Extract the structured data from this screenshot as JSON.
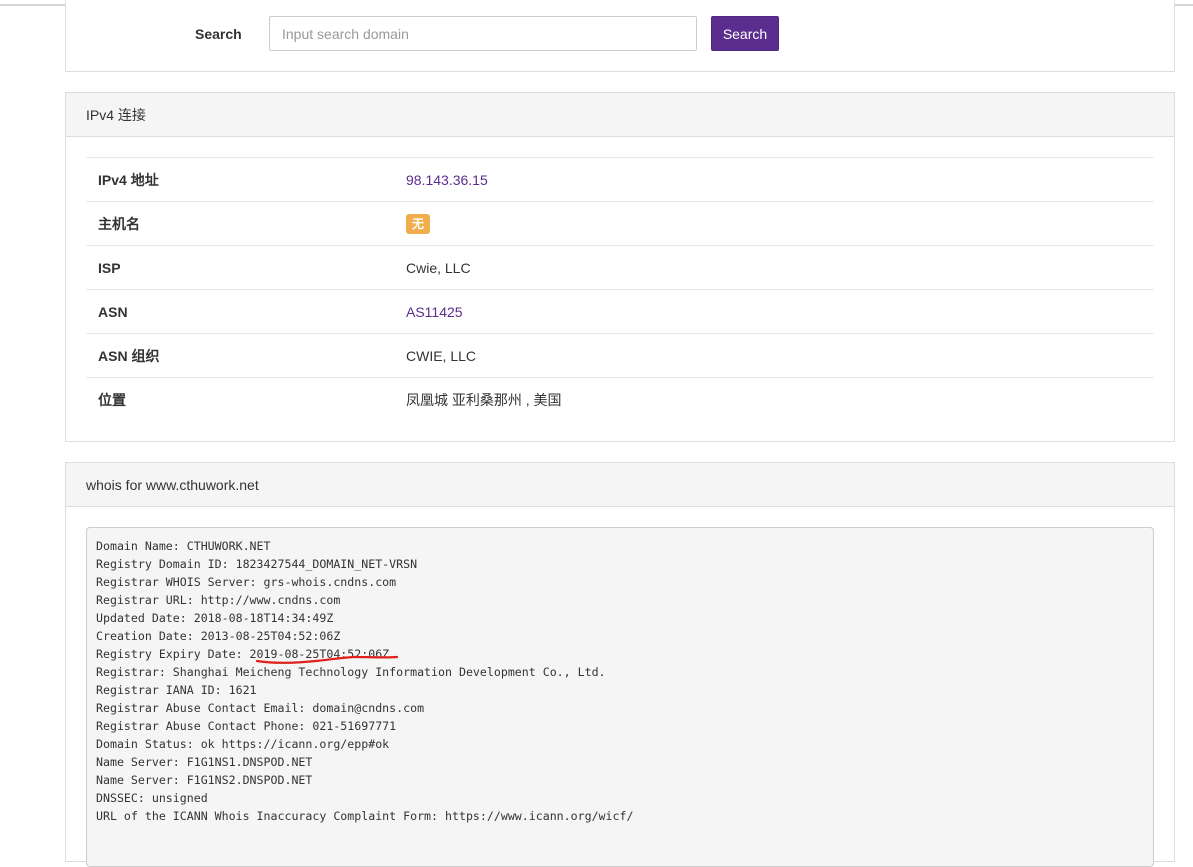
{
  "search": {
    "label": "Search",
    "placeholder": "Input search domain",
    "value": "",
    "button_label": "Search",
    "button_color": "#5b2d8e"
  },
  "ipv4": {
    "heading": "IPv4 连接",
    "rows": [
      {
        "key": "IPv4 地址",
        "value": "98.143.36.15",
        "type": "link"
      },
      {
        "key": "主机名",
        "value": "无",
        "type": "badge"
      },
      {
        "key": "ISP",
        "value": "Cwie, LLC",
        "type": "text"
      },
      {
        "key": "ASN",
        "value": "AS11425",
        "type": "link"
      },
      {
        "key": "ASN 组织",
        "value": "CWIE, LLC",
        "type": "text"
      },
      {
        "key": "位置",
        "value": "凤凰城 亚利桑那州 , 美国",
        "type": "text"
      }
    ]
  },
  "whois": {
    "heading": "whois for www.cthuwork.net",
    "lines": [
      "Domain Name: CTHUWORK.NET",
      "Registry Domain ID: 1823427544_DOMAIN_NET-VRSN",
      "Registrar WHOIS Server: grs-whois.cndns.com",
      "Registrar URL: http://www.cndns.com",
      "Updated Date: 2018-08-18T14:34:49Z",
      "Creation Date: 2013-08-25T04:52:06Z",
      "Registry Expiry Date: 2019-08-25T04:52:06Z",
      "Registrar: Shanghai Meicheng Technology Information Development Co., Ltd.",
      "Registrar IANA ID: 1621",
      "Registrar Abuse Contact Email: domain@cndns.com",
      "Registrar Abuse Contact Phone: 021-51697771",
      "Domain Status: ok https://icann.org/epp#ok",
      "Name Server: F1G1NS1.DNSPOD.NET",
      "Name Server: F1G1NS2.DNSPOD.NET",
      "DNSSEC: unsigned",
      "URL of the ICANN Whois Inaccuracy Complaint Form: https://www.icann.org/wicf/"
    ]
  },
  "colors": {
    "accent": "#5b2d8e",
    "badge": "#f0ad4e",
    "annotation": "#e0201c"
  }
}
